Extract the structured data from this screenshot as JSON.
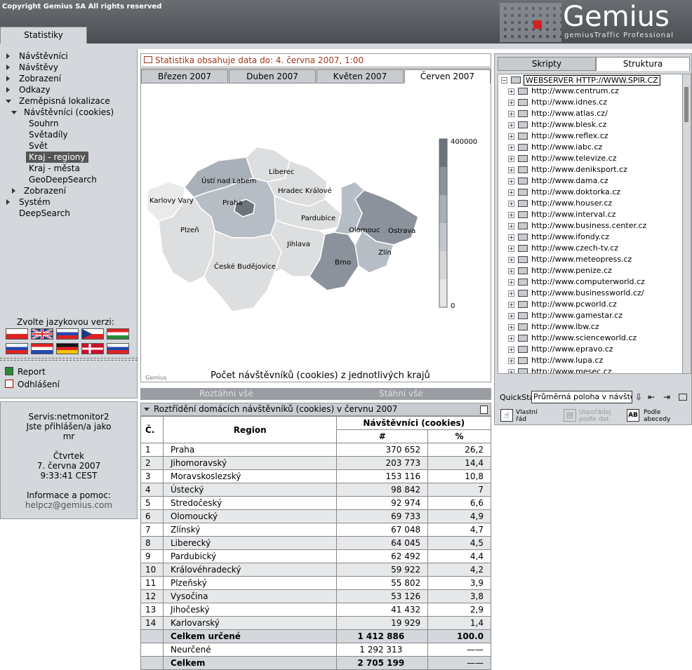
{
  "header": {
    "copyright": "Copyright Gemius SA   All rights reserved",
    "logo": "Gemius",
    "tagline": "gemiusTraffic Professional",
    "tab": "Statistiky"
  },
  "nav": {
    "items": [
      "Návštěvníci",
      "Návštěvy",
      "Zobrazení",
      "Odkazy",
      "Zeměpisná lokalizace",
      "Návštěvníci (cookies)",
      "Souhrn",
      "Světadíly",
      "Svět",
      "Kraj - regiony",
      "Kraj - města",
      "GeoDeepSearch",
      "Zobrazení",
      "Systém",
      "DeepSearch"
    ]
  },
  "lang": {
    "label": "Zvolte jazykovou verzi:"
  },
  "links": {
    "report": "Report",
    "logout": "Odhlášení"
  },
  "info": {
    "service": "Servis:netmonitor2",
    "logged": "Jste přihlášen/a jako",
    "user": "mr",
    "day": "Čtvrtek",
    "date": "7. června 2007",
    "time": "9:33:41 CEST",
    "help": "Informace a pomoc:",
    "email": "helpcz@gemius.com"
  },
  "map": {
    "info": "Statistika obsahuje data do: 4. června 2007, 1:00",
    "tabs": [
      "Březen 2007",
      "Duben 2007",
      "Květen 2007",
      "Červen 2007"
    ],
    "caption": "Počet návštěvníků (cookies) z jednotlivých krajů",
    "brand": "Gemius",
    "legend_max": "400000",
    "legend_min": "0",
    "cities": [
      "Liberec",
      "Ústí nad Labem",
      "Hradec Králové",
      "Karlovy Vary",
      "Praha",
      "Pardubice",
      "Olomouc",
      "Ostrava",
      "Plzeň",
      "Jihlava",
      "Zlín",
      "České Budějovice",
      "Brno"
    ]
  },
  "buttons": {
    "expand": "Roztáhni vše",
    "collapse": "Stáhni vše"
  },
  "table": {
    "title": "Roztřídění domácích návštěvníků (cookies) v červnu 2007",
    "h_num": "Č.",
    "h_region": "Region",
    "h_visitors": "Návštěvníci (cookies)",
    "h_hash": "#",
    "h_pct": "%",
    "rows": [
      [
        "1",
        "Praha",
        "370 652",
        "26,2"
      ],
      [
        "2",
        "Jihomoravský",
        "203 773",
        "14,4"
      ],
      [
        "3",
        "Moravskoslezský",
        "153 116",
        "10,8"
      ],
      [
        "4",
        "Ústecký",
        "98 842",
        "7"
      ],
      [
        "5",
        "Stredočeský",
        "92 974",
        "6,6"
      ],
      [
        "6",
        "Olomoucký",
        "69 733",
        "4,9"
      ],
      [
        "7",
        "Zlínský",
        "67 048",
        "4,7"
      ],
      [
        "8",
        "Liberecký",
        "64 045",
        "4,5"
      ],
      [
        "9",
        "Pardubický",
        "62 492",
        "4,4"
      ],
      [
        "10",
        "Královéhradecký",
        "59 922",
        "4,2"
      ],
      [
        "11",
        "Plzeňský",
        "55 802",
        "3,9"
      ],
      [
        "12",
        "Vysočina",
        "53 126",
        "3,8"
      ],
      [
        "13",
        "Jihočeský",
        "41 432",
        "2,9"
      ],
      [
        "14",
        "Karlovarský",
        "19 929",
        "1,4"
      ]
    ],
    "tot1": [
      "Celkem určené",
      "1 412 886",
      "100.0"
    ],
    "tot2": [
      "Neurčené",
      "1 292 313",
      "——"
    ],
    "tot3": [
      "Celkem",
      "2 705 199",
      "——"
    ]
  },
  "right": {
    "tabs": [
      "Skripty",
      "Struktura"
    ],
    "root": "WEBSERVER HTTP://WWW.SPIR.CZ",
    "sites": [
      "http://www.centrum.cz",
      "http://www.idnes.cz",
      "http://www.atlas.cz/",
      "http://www.blesk.cz",
      "http://www.reflex.cz",
      "http://www.iabc.cz",
      "http://www.televize.cz",
      "http://www.deniksport.cz",
      "http://www.dama.cz",
      "http://www.doktorka.cz",
      "http://www.houser.cz",
      "http://www.interval.cz",
      "http://www.business.center.cz",
      "http://www.ifondy.cz",
      "http://www.czech-tv.cz",
      "http://www.meteopress.cz",
      "http://www.penize.cz",
      "http://www.computerworld.cz",
      "http://www.businessworld.cz/",
      "http://www.pcworld.cz",
      "http://www.gamestar.cz",
      "http://www.lbw.cz",
      "http://www.scienceworld.cz",
      "http://www.epravo.cz",
      "http://www.lupa.cz",
      "http://www.mesec.cz"
    ],
    "quickstat": "QuickStat",
    "select": "Průměrná poloha v návštěvě",
    "sort1a": "Vlastní",
    "sort1b": "řád",
    "sort2a": "Uspořádej",
    "sort2b": "podle dat",
    "sort3a": "Podle",
    "sort3b": "abecedy",
    "ab": "AB"
  }
}
